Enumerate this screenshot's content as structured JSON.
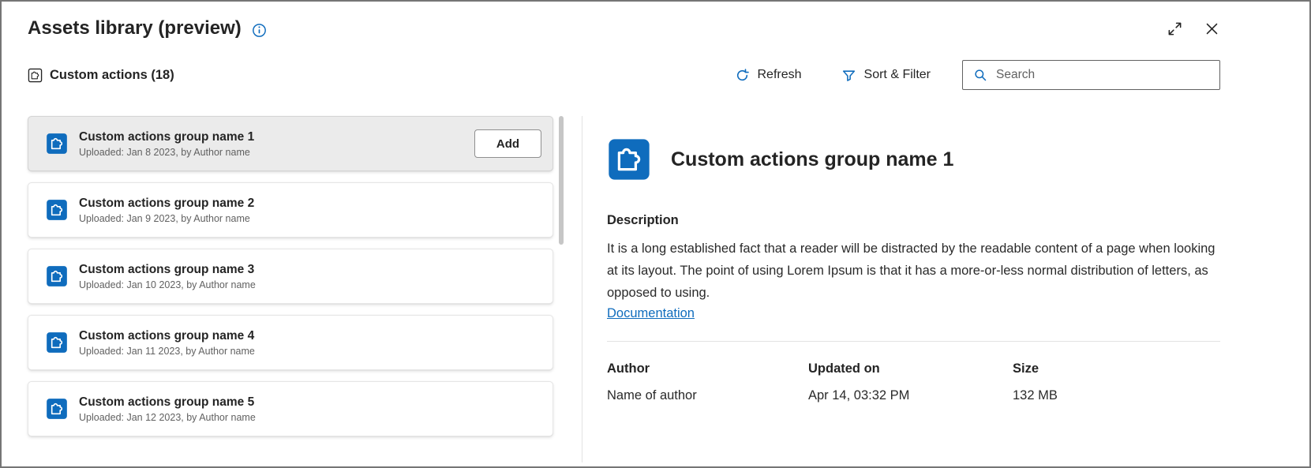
{
  "dialog": {
    "title": "Assets library (preview)"
  },
  "toolbar": {
    "section_label": "Custom actions (18)",
    "refresh": "Refresh",
    "sort_filter": "Sort & Filter",
    "search_placeholder": "Search"
  },
  "list": {
    "items": [
      {
        "title": "Custom actions group name 1",
        "meta": "Uploaded: Jan 8 2023, by Author name",
        "selected": true,
        "action": "Add"
      },
      {
        "title": "Custom actions group name 2",
        "meta": "Uploaded: Jan 9 2023, by Author name",
        "selected": false
      },
      {
        "title": "Custom actions group name 3",
        "meta": "Uploaded: Jan 10 2023, by Author name",
        "selected": false
      },
      {
        "title": "Custom actions group name 4",
        "meta": "Uploaded: Jan 11 2023, by Author name",
        "selected": false
      },
      {
        "title": "Custom actions group name 5",
        "meta": "Uploaded: Jan 12 2023, by Author name",
        "selected": false
      }
    ]
  },
  "detail": {
    "title": "Custom actions group name 1",
    "description_heading": "Description",
    "description_text": "It is a long established fact that a reader will be distracted by the readable content of a page when looking at its layout. The point of using Lorem Ipsum is that it has a more-or-less normal distribution of letters, as opposed to using.",
    "link": "Documentation",
    "fields": [
      {
        "label": "Author",
        "value": "Name of author"
      },
      {
        "label": "Updated on",
        "value": "Apr 14, 03:32 PM"
      },
      {
        "label": "Size",
        "value": "132 MB"
      }
    ]
  },
  "icons": {
    "title_info": "info-icon",
    "window": [
      "expand-icon",
      "close-icon"
    ],
    "section": "puzzle-outline-icon",
    "refresh": "refresh-icon",
    "sort_filter": "filter-icon",
    "search": "search-icon",
    "list_item": "puzzle-tile-icon"
  },
  "colors": {
    "accent": "#0f6cbd",
    "text": "#242424",
    "muted": "#616161",
    "selected_bg": "#ebebeb"
  }
}
